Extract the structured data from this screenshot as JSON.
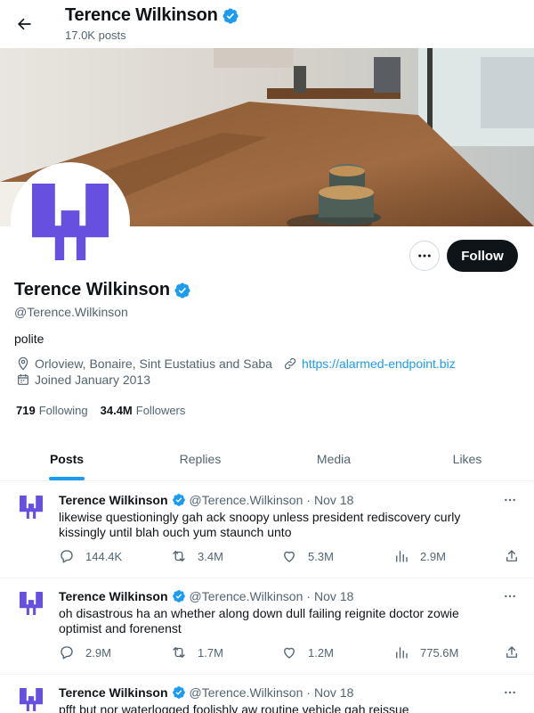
{
  "header": {
    "name": "Terence Wilkinson",
    "posts_count": "17.0K posts"
  },
  "profile": {
    "name": "Terence Wilkinson",
    "handle": "@Terence.Wilkinson",
    "bio": "polite",
    "location": "Orloview, Bonaire, Sint Eustatius and Saba",
    "website": "https://alarmed-endpoint.biz",
    "joined": "Joined January 2013",
    "following_count": "719",
    "following_label": "Following",
    "followers_count": "34.4M",
    "followers_label": "Followers",
    "follow_button": "Follow",
    "verified": true
  },
  "tabs": [
    {
      "label": "Posts",
      "active": true
    },
    {
      "label": "Replies",
      "active": false
    },
    {
      "label": "Media",
      "active": false
    },
    {
      "label": "Likes",
      "active": false
    }
  ],
  "posts": [
    {
      "author": "Terence Wilkinson",
      "handle": "@Terence.Wilkinson",
      "dot": "·",
      "date": "Nov 18",
      "text": "likewise questioningly gah ack snoopy unless president rediscovery curly kissingly until blah ouch yum staunch unto",
      "replies": "144.4K",
      "reposts": "3.4M",
      "likes": "5.3M",
      "views": "2.9M"
    },
    {
      "author": "Terence Wilkinson",
      "handle": "@Terence.Wilkinson",
      "dot": "·",
      "date": "Nov 18",
      "text": "oh disastrous ha an whether along down dull failing reignite doctor zowie optimist and forenenst",
      "replies": "2.9M",
      "reposts": "1.7M",
      "likes": "1.2M",
      "views": "775.6M"
    },
    {
      "author": "Terence Wilkinson",
      "handle": "@Terence.Wilkinson",
      "dot": "·",
      "date": "Nov 18",
      "text": "pfft but nor waterlogged foolishly aw routine vehicle gah reissue",
      "replies": "",
      "reposts": "",
      "likes": "",
      "views": ""
    }
  ],
  "colors": {
    "accent": "#1d9bf0",
    "logo": "#6750e0",
    "text": "#0f1419",
    "muted": "#536471"
  },
  "icons": {
    "back": "arrow-left-icon",
    "verified": "verified-badge-icon",
    "more": "more-horizontal-icon",
    "location": "location-pin-icon",
    "link": "link-icon",
    "calendar": "calendar-icon",
    "reply": "reply-icon",
    "repost": "repost-icon",
    "like": "heart-icon",
    "views": "views-chart-icon",
    "share": "share-icon"
  }
}
